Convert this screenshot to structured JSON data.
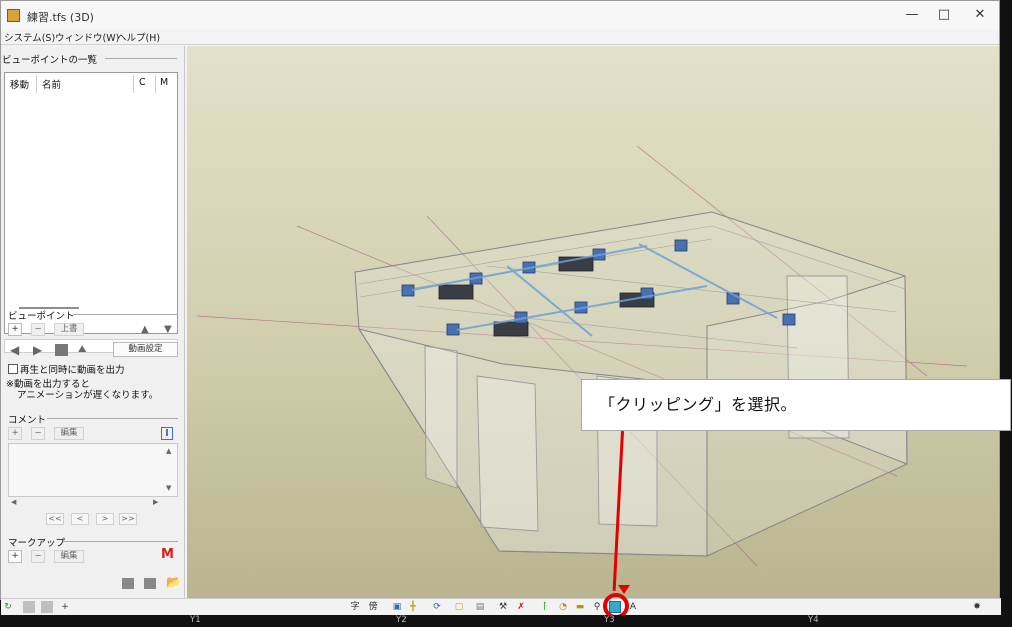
{
  "window": {
    "title": "練習.tfs (3D)"
  },
  "menu": [
    "システム(S)",
    "ウィンドウ(W)",
    "ヘルプ(H)"
  ],
  "viewpoint_list": {
    "heading": "ビューポイントの一覧",
    "columns": [
      "移動",
      "名前",
      "C",
      "M"
    ]
  },
  "viewpoint": {
    "heading": "ビューポイント",
    "overwrite_label": "上書",
    "video_settings_label": "動画設定",
    "checkbox_label": "再生と同時に動画を出力",
    "note_line1": "※動画を出力すると",
    "note_line2": "アニメーションが遅くなります。"
  },
  "comment": {
    "heading": "コメント",
    "edit_label": "編集"
  },
  "markup": {
    "heading": "マークアップ",
    "edit_label": "編集"
  },
  "callout": {
    "text": "「クリッピング」を選択。"
  },
  "bottom_labels": [
    "Y1",
    "Y2",
    "Y3",
    "Y4"
  ],
  "colors": {
    "highlight": "#e30000",
    "viewport_top": "#e2e1c9",
    "viewport_bottom": "#b9b48f"
  }
}
